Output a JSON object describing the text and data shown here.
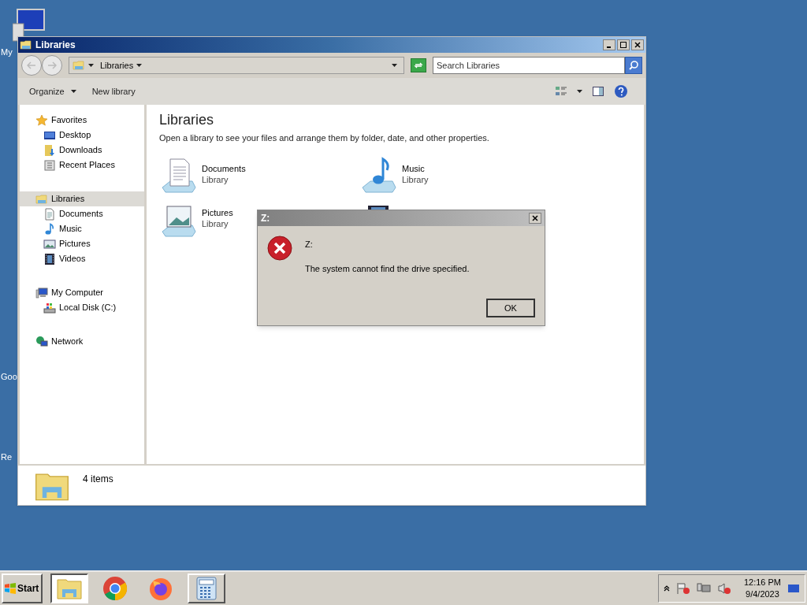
{
  "desktop": {
    "labels": [
      "My",
      "Goo",
      "Re"
    ]
  },
  "window": {
    "title": "Libraries",
    "address": {
      "crumb": "Libraries"
    },
    "search": {
      "placeholder": "Search Libraries"
    },
    "toolbar": [
      {
        "label": "Organize",
        "menu": true
      },
      {
        "label": "New library",
        "menu": false
      }
    ],
    "sidebar": {
      "groups": [
        {
          "label": "Favorites",
          "selected": false,
          "children": [
            {
              "label": "Desktop",
              "selected": false
            },
            {
              "label": "Downloads",
              "selected": false
            },
            {
              "label": "Recent Places",
              "selected": false
            }
          ]
        },
        {
          "label": "Libraries",
          "selected": true,
          "children": [
            {
              "label": "Documents",
              "selected": false
            },
            {
              "label": "Music",
              "selected": false
            },
            {
              "label": "Pictures",
              "selected": false
            },
            {
              "label": "Videos",
              "selected": false
            }
          ]
        },
        {
          "label": "My Computer",
          "selected": false,
          "children": [
            {
              "label": "Local Disk (C:)",
              "selected": false
            }
          ]
        },
        {
          "label": "Network",
          "selected": false
        }
      ]
    },
    "content": {
      "heading": "Libraries",
      "description": "Open a library to see your files and arrange them by folder, date, and other properties.",
      "items": [
        {
          "kind": "library",
          "name": "Documents",
          "type": "Library"
        },
        {
          "kind": "library",
          "name": "Music",
          "type": "Library"
        },
        {
          "kind": "library",
          "name": "Pictures",
          "type": "Library"
        },
        {
          "kind": "icon_only"
        }
      ]
    },
    "status": {
      "text": "4 items"
    }
  },
  "dialog": {
    "title": "Z:",
    "heading": "Z:",
    "message": "The system cannot find the drive specified.",
    "button": "OK"
  },
  "taskbar": {
    "start": "Start",
    "apps": [
      {
        "kind": "explorer",
        "selected": true
      },
      {
        "kind": "chrome",
        "selected": false
      },
      {
        "kind": "firefox",
        "selected": false
      },
      {
        "kind": "calculator",
        "selected": false
      }
    ],
    "time": "12:16 PM",
    "date": "9/4/2023"
  }
}
